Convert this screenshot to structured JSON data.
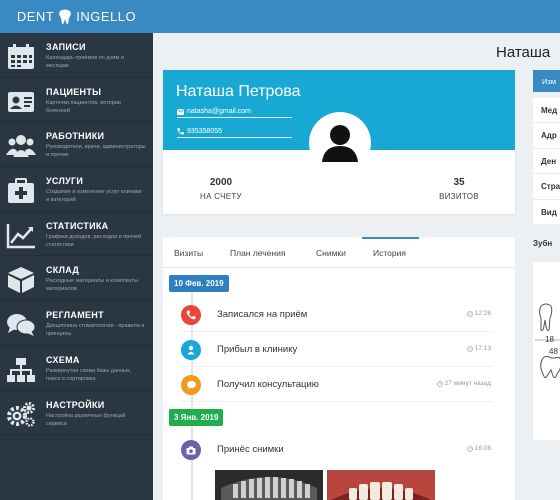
{
  "brand": {
    "left": "DENT",
    "right": "INGELLO"
  },
  "menu": [
    {
      "title": "ЗАПИСИ",
      "desc": "Календарь приёмов по дням и месяцам",
      "icon": "calendar-icon"
    },
    {
      "title": "ПАЦИЕНТЫ",
      "desc": "Карточки пациентов, истории болезней",
      "icon": "id-card-icon"
    },
    {
      "title": "РАБОТНИКИ",
      "desc": "Руководители, врачи, администраторы и прочие",
      "icon": "users-icon"
    },
    {
      "title": "УСЛУГИ",
      "desc": "Создание и изменение услуг клиники и категорий",
      "icon": "medkit-icon"
    },
    {
      "title": "СТАТИСТИКА",
      "desc": "Графики доходов, расходов и прочей статистики",
      "icon": "chart-icon"
    },
    {
      "title": "СКЛАД",
      "desc": "Расходные материалы и комплекты материалов",
      "icon": "box-icon"
    },
    {
      "title": "РЕГЛАМЕНТ",
      "desc": "Дисциплина стоматологии - правила и принципы",
      "icon": "chat-icon"
    },
    {
      "title": "СХЕМА",
      "desc": "Развёрнутая схема базы данных, поиск и сортировка",
      "icon": "sitemap-icon"
    },
    {
      "title": "НАСТРОЙКИ",
      "desc": "Настройка различных функций сервиса",
      "icon": "gears-icon"
    }
  ],
  "page_title": "Наташа",
  "profile": {
    "name": "Наташа Петрова",
    "email": "natasha@gmail.com",
    "phone": "935358055",
    "balance": "2000",
    "balance_label": "НА СЧЕТУ",
    "visits": "35",
    "visits_label": "ВИЗИТОВ"
  },
  "tabs": [
    "Визиты",
    "План лечения",
    "Снимки",
    "История"
  ],
  "active_tab": "История",
  "timeline": [
    {
      "date": "10 Фев. 2019",
      "color": "#2c7fc0"
    },
    {
      "date": "3 Янв. 2019",
      "color": "#1fae4b"
    }
  ],
  "events": [
    {
      "text": "Записался на приём",
      "time": "12:28",
      "color": "#e8473c",
      "icon": "phone-icon"
    },
    {
      "text": "Прибыл в клинику",
      "time": "17:13",
      "color": "#16a7d6",
      "icon": "person-icon"
    },
    {
      "text": "Получил консультацию",
      "time": "27 минут назад",
      "color": "#f29a1f",
      "icon": "chat-icon"
    },
    {
      "text": "Принёс снимки",
      "time": "16:08",
      "color": "#6a63a8",
      "icon": "camera-icon"
    }
  ],
  "right": {
    "button": "Изм",
    "rows": [
      "Мед",
      "Адр",
      "Ден",
      "Стра",
      "Вид"
    ],
    "subtitle": "Зубн",
    "tooth_numbers": [
      "18",
      "48"
    ]
  },
  "colors": {
    "primary": "#3989c3",
    "sidebar": "#2a3743",
    "cyan": "#17a9d4"
  }
}
